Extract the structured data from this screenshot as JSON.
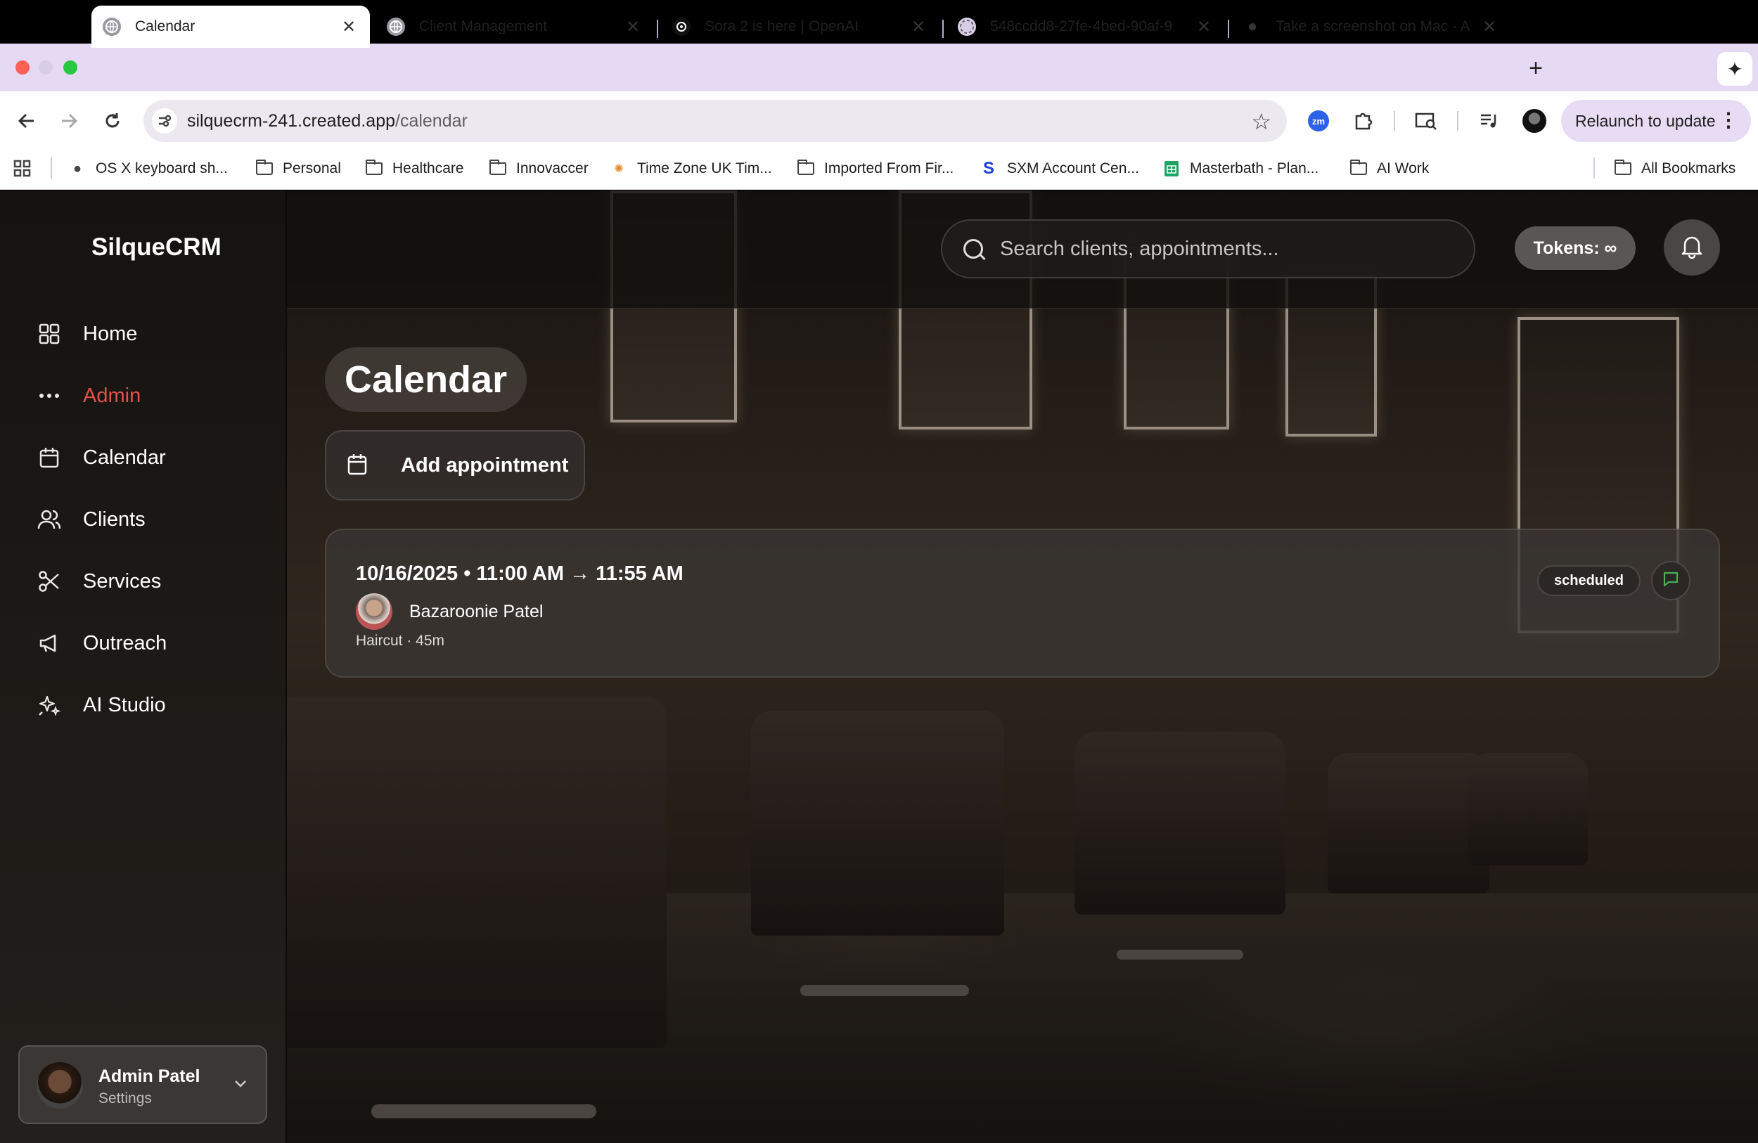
{
  "browser": {
    "tabs": [
      {
        "title": "Calendar",
        "active": true
      },
      {
        "title": "Client Management",
        "active": false
      },
      {
        "title": "Sora 2 is here | OpenAI",
        "active": false
      },
      {
        "title": "548ccdd8-27fe-4bed-90af-9",
        "active": false
      },
      {
        "title": "Take a screenshot on Mac - A",
        "active": false
      }
    ],
    "url_host": "silquecrm-241.created.app",
    "url_path": "/calendar",
    "relaunch_label": "Relaunch to update",
    "zoom_ext_label": "zm",
    "bookmarks": [
      {
        "label": "OS X keyboard sh...",
        "icon": "apple-icon"
      },
      {
        "label": "Personal",
        "icon": "folder-icon"
      },
      {
        "label": "Healthcare",
        "icon": "folder-icon"
      },
      {
        "label": "Innovaccer",
        "icon": "folder-icon"
      },
      {
        "label": "Time Zone UK Tim...",
        "icon": "timezone-icon"
      },
      {
        "label": "Imported From Fir...",
        "icon": "folder-icon"
      },
      {
        "label": "SXM Account Cen...",
        "icon": "sxm-icon"
      },
      {
        "label": "Masterbath - Plan...",
        "icon": "sheets-icon"
      },
      {
        "label": "AI Work",
        "icon": "folder-icon"
      }
    ],
    "all_bookmarks_label": "All Bookmarks"
  },
  "app": {
    "brand": "SilqueCRM",
    "search_placeholder": "Search clients, appointments...",
    "tokens_label": "Tokens: ∞",
    "nav": [
      {
        "label": "Home",
        "icon": "grid-icon",
        "active": false
      },
      {
        "label": "Admin",
        "icon": "dots-icon",
        "active": true
      },
      {
        "label": "Calendar",
        "icon": "calendar-icon",
        "active": false
      },
      {
        "label": "Clients",
        "icon": "users-icon",
        "active": false
      },
      {
        "label": "Services",
        "icon": "scissors-icon",
        "active": false
      },
      {
        "label": "Outreach",
        "icon": "megaphone-icon",
        "active": false
      },
      {
        "label": "AI Studio",
        "icon": "sparkles-icon",
        "active": false
      }
    ],
    "user": {
      "name": "Admin Patel",
      "subtitle": "Settings"
    },
    "page_title": "Calendar",
    "add_button_label": "Add appointment",
    "appointments": [
      {
        "when": "10/16/2025 • 11:00 AM → 11:55 AM",
        "client": "Bazaroonie Patel",
        "service": "Haircut · 45m",
        "status": "scheduled"
      }
    ]
  },
  "colors": {
    "tab_strip": "#e6d9f3",
    "active_nav": "#e0534a",
    "message_icon": "#4caf50"
  }
}
